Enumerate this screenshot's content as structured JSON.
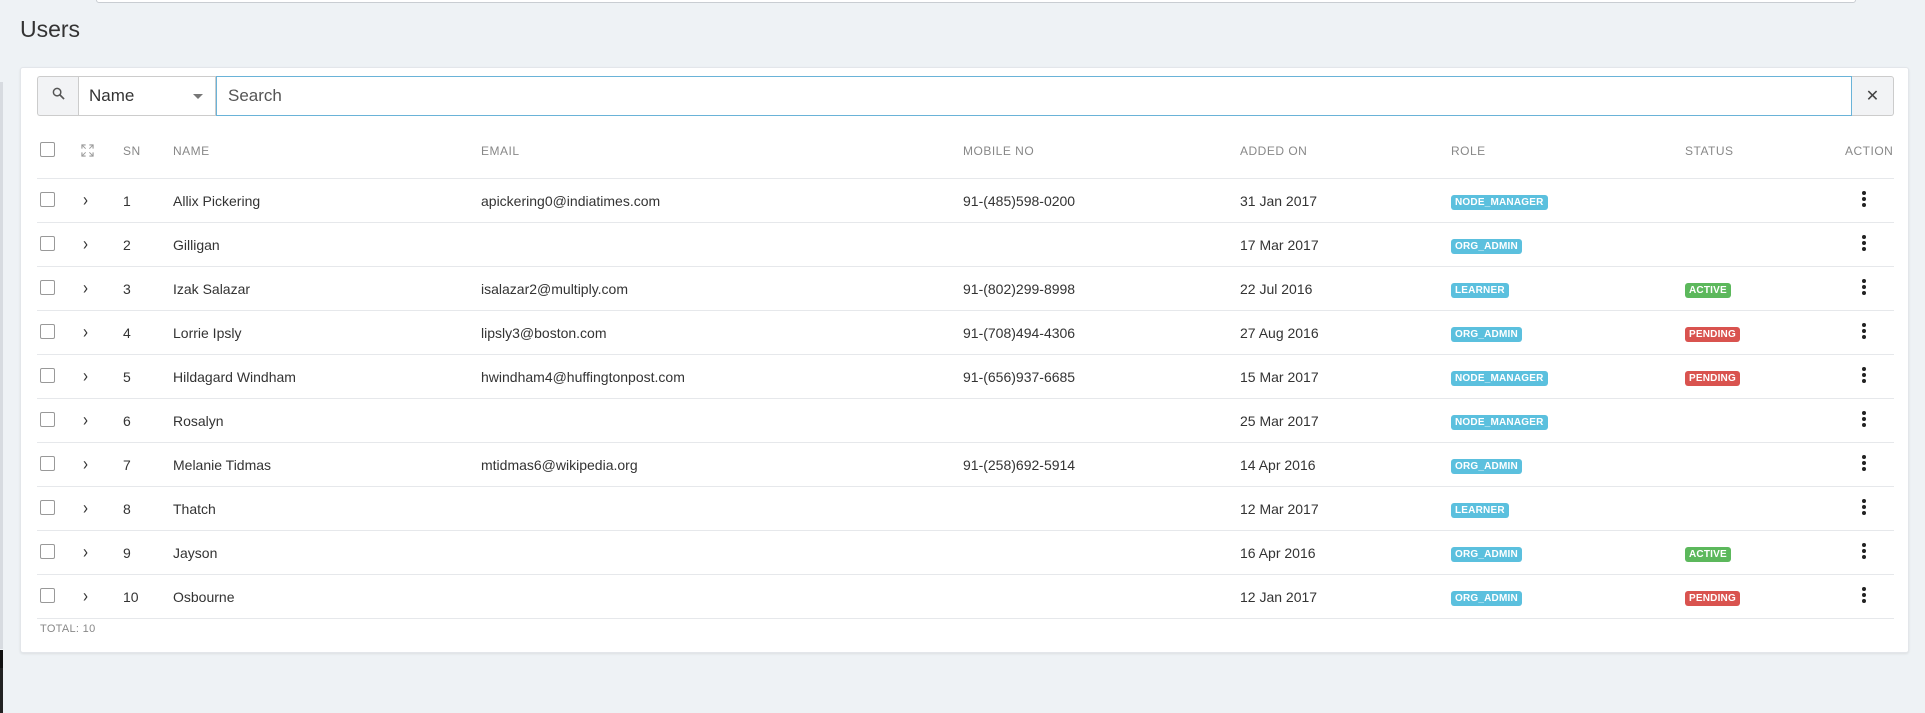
{
  "page": {
    "title": "Users"
  },
  "search": {
    "field": "Name",
    "placeholder": "Search",
    "value": "",
    "clear_symbol": "✕"
  },
  "columns": {
    "sn": "SN",
    "name": "NAME",
    "email": "EMAIL",
    "mobile": "MOBILE NO",
    "added_on": "ADDED ON",
    "role": "ROLE",
    "status": "STATUS",
    "action": "ACTION"
  },
  "rows": [
    {
      "sn": "1",
      "name": "Allix Pickering",
      "email": "apickering0@indiatimes.com",
      "mobile": "91-(485)598-0200",
      "added_on": "31 Jan 2017",
      "role": "NODE_MANAGER",
      "status": ""
    },
    {
      "sn": "2",
      "name": "Gilligan",
      "email": "",
      "mobile": "",
      "added_on": "17 Mar 2017",
      "role": "ORG_ADMIN",
      "status": ""
    },
    {
      "sn": "3",
      "name": "Izak Salazar",
      "email": "isalazar2@multiply.com",
      "mobile": "91-(802)299-8998",
      "added_on": "22 Jul 2016",
      "role": "LEARNER",
      "status": "ACTIVE"
    },
    {
      "sn": "4",
      "name": "Lorrie Ipsly",
      "email": "lipsly3@boston.com",
      "mobile": "91-(708)494-4306",
      "added_on": "27 Aug 2016",
      "role": "ORG_ADMIN",
      "status": "PENDING"
    },
    {
      "sn": "5",
      "name": "Hildagard Windham",
      "email": "hwindham4@huffingtonpost.com",
      "mobile": "91-(656)937-6685",
      "added_on": "15 Mar 2017",
      "role": "NODE_MANAGER",
      "status": "PENDING"
    },
    {
      "sn": "6",
      "name": "Rosalyn",
      "email": "",
      "mobile": "",
      "added_on": "25 Mar 2017",
      "role": "NODE_MANAGER",
      "status": ""
    },
    {
      "sn": "7",
      "name": "Melanie Tidmas",
      "email": "mtidmas6@wikipedia.org",
      "mobile": "91-(258)692-5914",
      "added_on": "14 Apr 2016",
      "role": "ORG_ADMIN",
      "status": ""
    },
    {
      "sn": "8",
      "name": "Thatch",
      "email": "",
      "mobile": "",
      "added_on": "12 Mar 2017",
      "role": "LEARNER",
      "status": ""
    },
    {
      "sn": "9",
      "name": "Jayson",
      "email": "",
      "mobile": "",
      "added_on": "16 Apr 2016",
      "role": "ORG_ADMIN",
      "status": "ACTIVE"
    },
    {
      "sn": "10",
      "name": "Osbourne",
      "email": "",
      "mobile": "",
      "added_on": "12 Jan 2017",
      "role": "ORG_ADMIN",
      "status": "PENDING"
    }
  ],
  "footer": {
    "total": "TOTAL: 10"
  },
  "colors": {
    "role_badge": "#5bc0de",
    "active_badge": "#5cb85c",
    "pending_badge": "#d9534f",
    "search_focus_border": "#6ab3d8"
  }
}
